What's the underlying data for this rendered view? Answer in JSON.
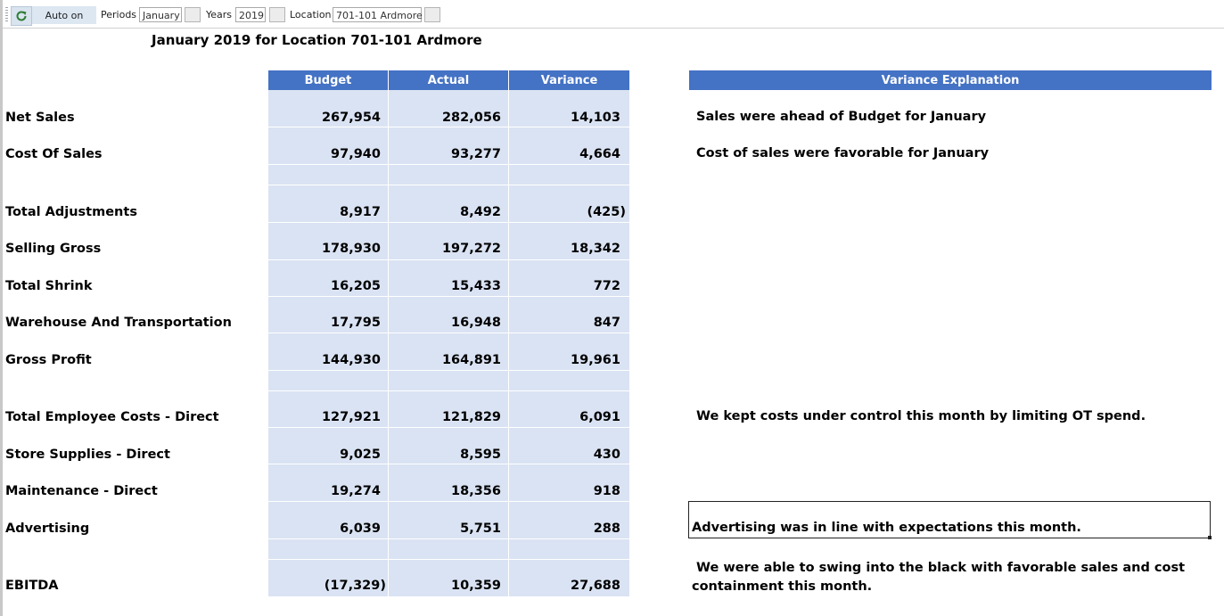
{
  "toolbar": {
    "auto_label": "Auto on",
    "periods_label": "Periods",
    "periods_value": "January",
    "years_label": "Years",
    "years_value": "2019",
    "location_label": "Location",
    "location_value": "701-101 Ardmore"
  },
  "report": {
    "title": "January 2019 for Location 701-101 Ardmore",
    "columns": [
      "Budget",
      "Actual",
      "Variance"
    ],
    "explanation_header": "Variance Explanation",
    "rows": [
      {
        "label": "Net Sales",
        "budget": "267,954",
        "actual": "282,056",
        "variance": "14,103",
        "explanation": "Sales were ahead of Budget for January"
      },
      {
        "label": "Cost Of Sales",
        "budget": "97,940",
        "actual": "93,277",
        "variance": "4,664",
        "explanation": "Cost of sales were favorable for January"
      },
      {
        "label": "Total Adjustments",
        "budget": "8,917",
        "actual": "8,492",
        "variance": "(425)",
        "explanation": ""
      },
      {
        "label": "Selling Gross",
        "budget": "178,930",
        "actual": "197,272",
        "variance": "18,342",
        "explanation": ""
      },
      {
        "label": "Total Shrink",
        "budget": "16,205",
        "actual": "15,433",
        "variance": "772",
        "explanation": ""
      },
      {
        "label": "Warehouse And Transportation",
        "budget": "17,795",
        "actual": "16,948",
        "variance": "847",
        "explanation": ""
      },
      {
        "label": "Gross Profit",
        "budget": "144,930",
        "actual": "164,891",
        "variance": "19,961",
        "explanation": ""
      },
      {
        "label": "Total Employee Costs - Direct",
        "budget": "127,921",
        "actual": "121,829",
        "variance": "6,091",
        "explanation": "We kept costs under control this month by limiting OT spend."
      },
      {
        "label": "Store Supplies - Direct",
        "budget": "9,025",
        "actual": "8,595",
        "variance": "430",
        "explanation": ""
      },
      {
        "label": "Maintenance - Direct",
        "budget": "19,274",
        "actual": "18,356",
        "variance": "918",
        "explanation": ""
      },
      {
        "label": "Advertising",
        "budget": "6,039",
        "actual": "5,751",
        "variance": "288",
        "explanation": "Advertising was in line with expectations this month."
      },
      {
        "label": "EBITDA",
        "budget": "(17,329)",
        "actual": "10,359",
        "variance": "27,688",
        "explanation": "We were able to swing into the black with favorable sales and cost containment this month."
      }
    ]
  },
  "colors": {
    "header_fill": "#4472c4",
    "cell_fill": "#dae3f3",
    "toolbar_button": "#dce7f2"
  }
}
